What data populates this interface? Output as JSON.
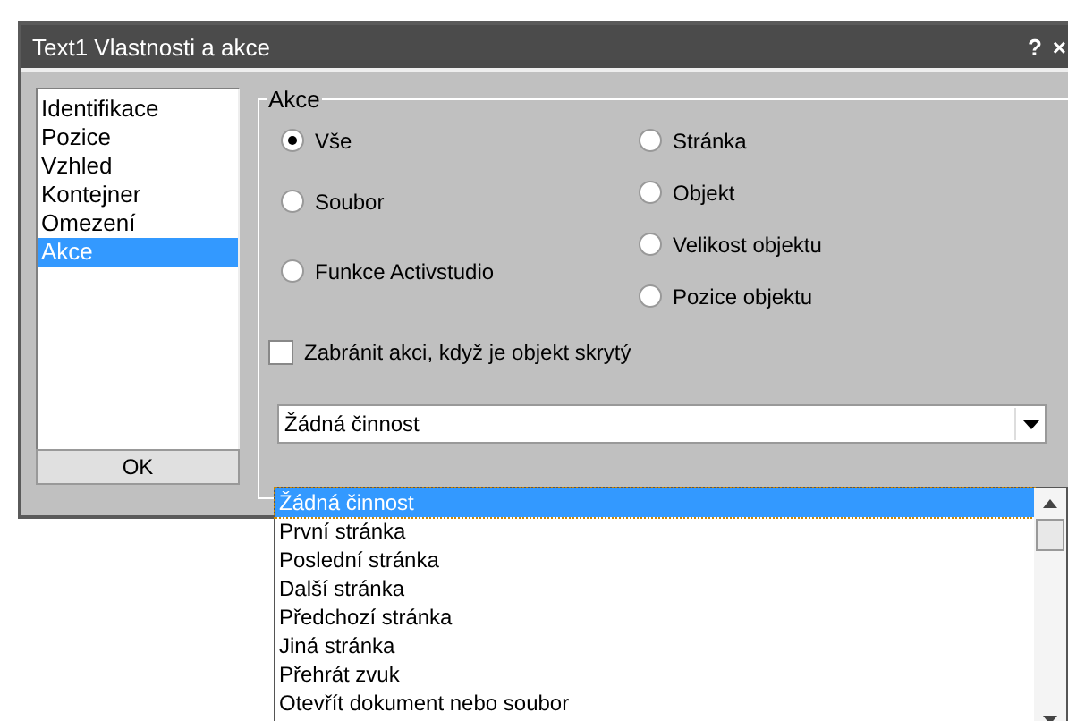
{
  "window": {
    "title": "Text1 Vlastnosti a akce",
    "help": "?",
    "close": "×"
  },
  "sidebar": {
    "items": [
      {
        "label": "Identifikace",
        "selected": false
      },
      {
        "label": "Pozice",
        "selected": false
      },
      {
        "label": "Vzhled",
        "selected": false
      },
      {
        "label": "Kontejner",
        "selected": false
      },
      {
        "label": "Omezení",
        "selected": false
      },
      {
        "label": "Akce",
        "selected": true
      }
    ]
  },
  "ok_button": "OK",
  "group": {
    "title": "Akce",
    "radios_left": [
      {
        "label": "Vše",
        "selected": true
      },
      {
        "label": "Soubor",
        "selected": false
      },
      {
        "label": "Funkce Activstudio",
        "selected": false
      }
    ],
    "radios_right": [
      {
        "label": "Stránka",
        "selected": false
      },
      {
        "label": "Objekt",
        "selected": false
      },
      {
        "label": "Velikost objektu",
        "selected": false
      },
      {
        "label": "Pozice objektu",
        "selected": false
      }
    ],
    "checkbox": {
      "label": "Zabránit akci, když je objekt skrytý",
      "checked": false
    },
    "dropdown": {
      "value": "Žádná činnost",
      "expanded": true,
      "options": [
        {
          "label": "Žádná činnost",
          "selected": true
        },
        {
          "label": "První stránka",
          "selected": false
        },
        {
          "label": "Poslední stránka",
          "selected": false
        },
        {
          "label": "Další stránka",
          "selected": false
        },
        {
          "label": "Předchozí stránka",
          "selected": false
        },
        {
          "label": "Jiná stránka",
          "selected": false
        },
        {
          "label": "Přehrát zvuk",
          "selected": false
        },
        {
          "label": "Otevřít dokument nebo soubor",
          "selected": false
        }
      ]
    }
  }
}
